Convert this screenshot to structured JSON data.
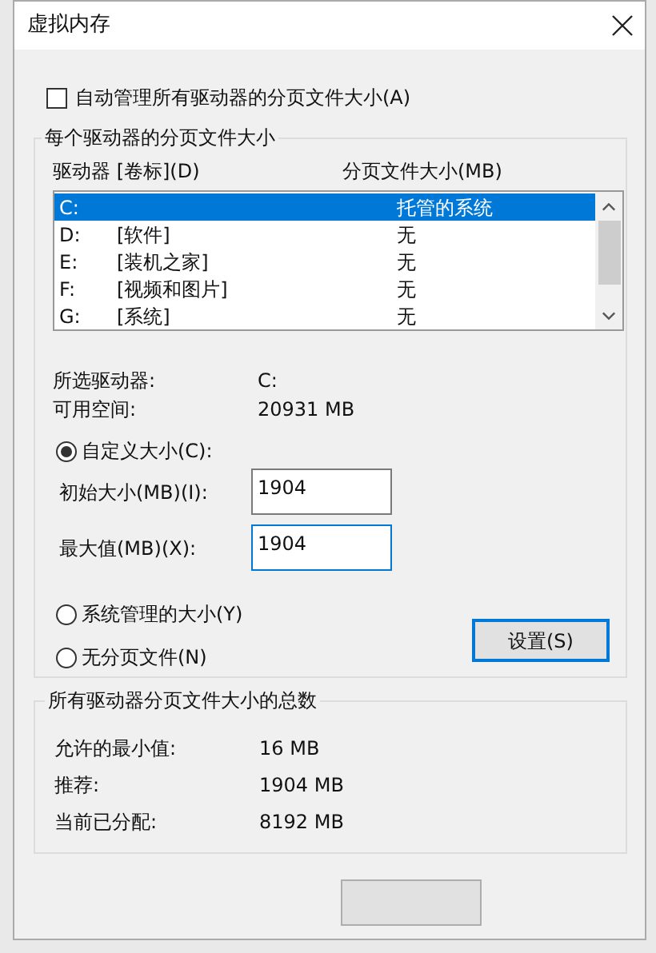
{
  "window": {
    "title": "虚拟内存"
  },
  "auto_manage": {
    "label": "自动管理所有驱动器的分页文件大小(A)",
    "checked": false
  },
  "per_drive": {
    "title": "每个驱动器的分页文件大小",
    "columns": [
      "驱动器 [卷标](D)",
      "分页文件大小(MB)"
    ],
    "rows": [
      {
        "drive": "C:",
        "label": "",
        "size": "托管的系统",
        "selected": true
      },
      {
        "drive": "D:",
        "label": "[软件]",
        "size": "无",
        "selected": false
      },
      {
        "drive": "E:",
        "label": "[装机之家]",
        "size": "无",
        "selected": false
      },
      {
        "drive": "F:",
        "label": "[视频和图片]",
        "size": "无",
        "selected": false
      },
      {
        "drive": "G:",
        "label": "[系统]",
        "size": "无",
        "selected": false
      }
    ],
    "info": [
      {
        "label": "所选驱动器:",
        "value": "C:"
      },
      {
        "label": "可用空间:",
        "value": "20931 MB"
      }
    ],
    "custom": {
      "label": "自定义大小(C):",
      "selected": true
    },
    "fields": [
      {
        "label": "初始大小(MB)(I):",
        "value": "1904",
        "focused": false
      },
      {
        "label": "最大值(MB)(X):",
        "value": "1904",
        "focused": true
      }
    ],
    "options": [
      {
        "label": "系统管理的大小(Y)",
        "selected": false
      },
      {
        "label": "无分页文件(N)",
        "selected": false
      }
    ],
    "set_button": "设置(S)"
  },
  "totals": {
    "title": "所有驱动器分页文件大小的总数",
    "rows": [
      {
        "label": "允许的最小值:",
        "value": "16 MB"
      },
      {
        "label": "推荐:",
        "value": "1904 MB"
      },
      {
        "label": "当前已分配:",
        "value": "8192 MB"
      }
    ]
  }
}
